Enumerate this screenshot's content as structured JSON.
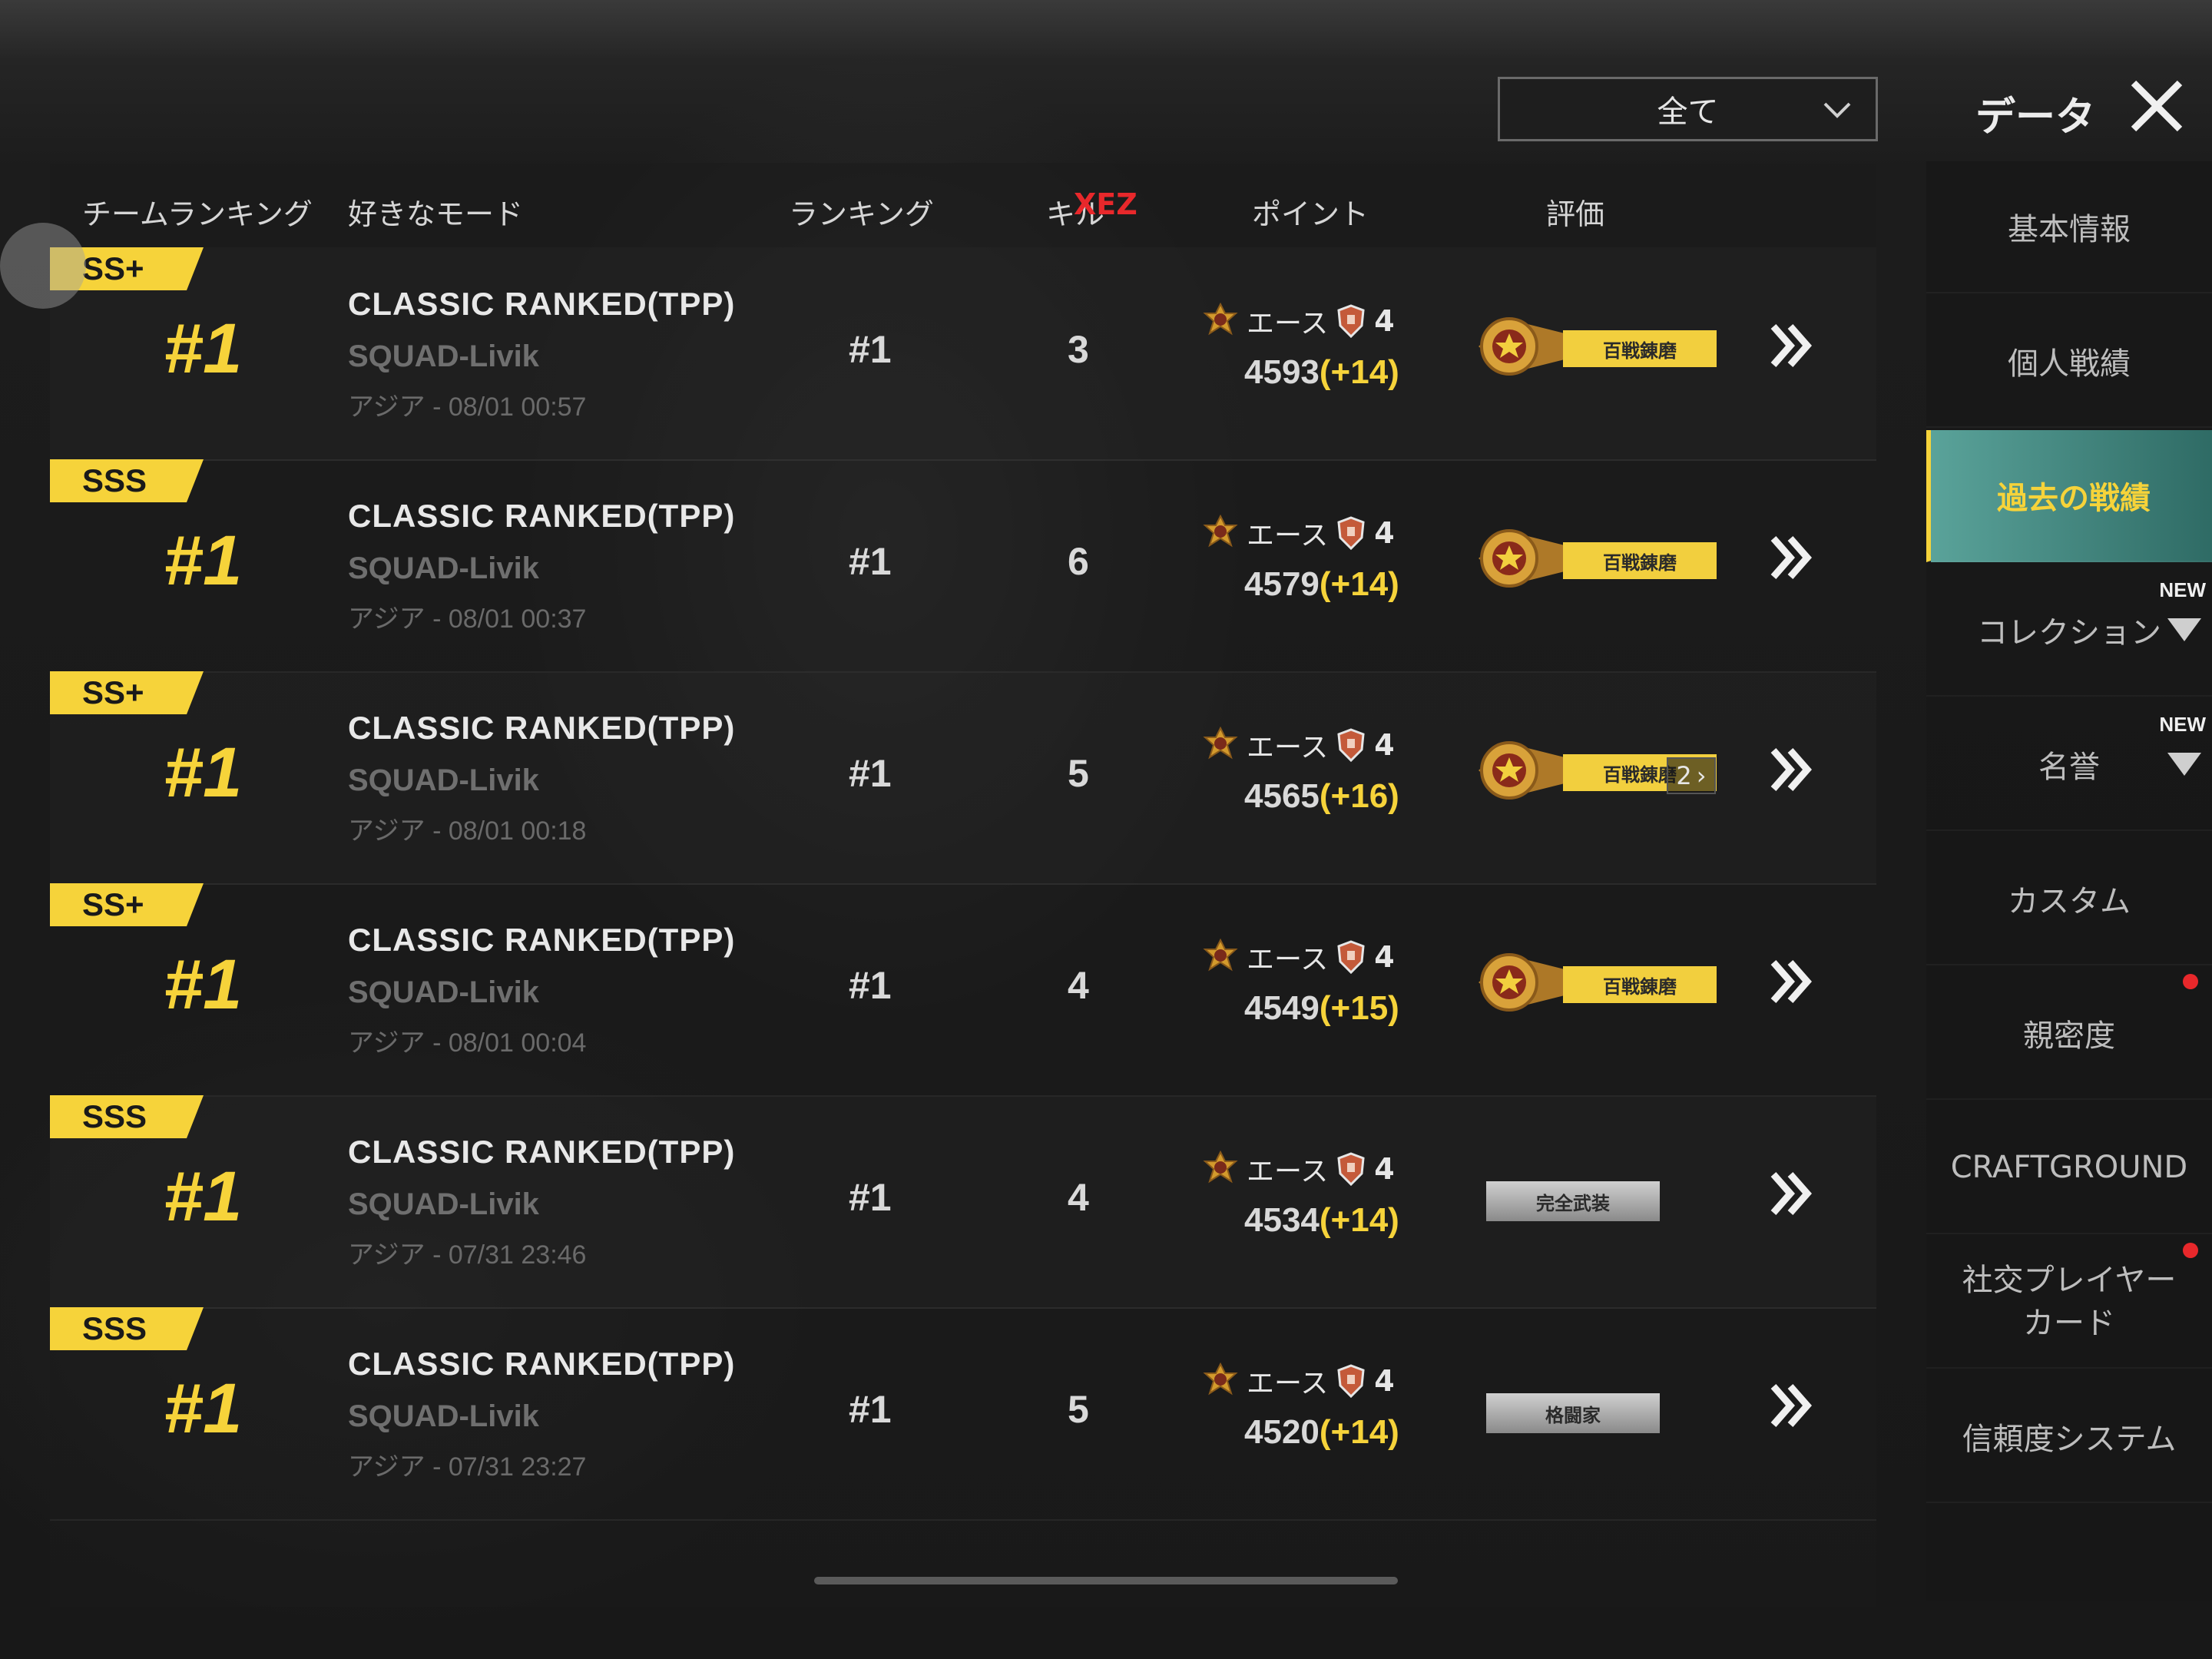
{
  "header": {
    "filter": "全て",
    "title": "データ"
  },
  "columns": {
    "team_ranking": "チームランキング",
    "favorite_mode": "好きなモード",
    "ranking": "ランキング",
    "kills": "キル",
    "kills_overlay": "XEZ",
    "points": "ポイント",
    "evaluation": "評価"
  },
  "rows": [
    {
      "grade": "SS+",
      "rank_big": "#1",
      "mode": "CLASSIC RANKED(TPP)",
      "squad": "SQUAD-Livik",
      "date": "アジア - 08/01 00:57",
      "ranking": "#1",
      "kills": "3",
      "tier": "エース",
      "tier_level": "4",
      "points": "4593",
      "delta": "(+14)",
      "eval": "百戦錬磨",
      "eval_style": "gold",
      "extra": ""
    },
    {
      "grade": "SSS",
      "rank_big": "#1",
      "mode": "CLASSIC RANKED(TPP)",
      "squad": "SQUAD-Livik",
      "date": "アジア - 08/01 00:37",
      "ranking": "#1",
      "kills": "6",
      "tier": "エース",
      "tier_level": "4",
      "points": "4579",
      "delta": "(+14)",
      "eval": "百戦錬磨",
      "eval_style": "gold",
      "extra": ""
    },
    {
      "grade": "SS+",
      "rank_big": "#1",
      "mode": "CLASSIC RANKED(TPP)",
      "squad": "SQUAD-Livik",
      "date": "アジア - 08/01 00:18",
      "ranking": "#1",
      "kills": "5",
      "tier": "エース",
      "tier_level": "4",
      "points": "4565",
      "delta": "(+16)",
      "eval": "百戦錬磨",
      "eval_style": "gold",
      "extra": "2"
    },
    {
      "grade": "SS+",
      "rank_big": "#1",
      "mode": "CLASSIC RANKED(TPP)",
      "squad": "SQUAD-Livik",
      "date": "アジア - 08/01 00:04",
      "ranking": "#1",
      "kills": "4",
      "tier": "エース",
      "tier_level": "4",
      "points": "4549",
      "delta": "(+15)",
      "eval": "百戦錬磨",
      "eval_style": "gold",
      "extra": ""
    },
    {
      "grade": "SSS",
      "rank_big": "#1",
      "mode": "CLASSIC RANKED(TPP)",
      "squad": "SQUAD-Livik",
      "date": "アジア - 07/31 23:46",
      "ranking": "#1",
      "kills": "4",
      "tier": "エース",
      "tier_level": "4",
      "points": "4534",
      "delta": "(+14)",
      "eval": "完全武装",
      "eval_style": "grey",
      "extra": ""
    },
    {
      "grade": "SSS",
      "rank_big": "#1",
      "mode": "CLASSIC RANKED(TPP)",
      "squad": "SQUAD-Livik",
      "date": "アジア - 07/31 23:27",
      "ranking": "#1",
      "kills": "5",
      "tier": "エース",
      "tier_level": "4",
      "points": "4520",
      "delta": "(+14)",
      "eval": "格闘家",
      "eval_style": "grey",
      "extra": ""
    }
  ],
  "sidebar": {
    "items": [
      {
        "label": "基本情報"
      },
      {
        "label": "個人戦績"
      },
      {
        "label": "過去の戦績",
        "active": true
      },
      {
        "label": "コレクション",
        "new": "NEW"
      },
      {
        "label": "名誉",
        "new": "NEW"
      },
      {
        "label": "カスタム"
      },
      {
        "label": "親密度",
        "dot": true
      },
      {
        "label": "CRAFTGROUND"
      },
      {
        "label": "社交プレイヤーカード",
        "dot": true
      },
      {
        "label": "信頼度システム"
      }
    ]
  },
  "colors": {
    "accent_yellow": "#f6d33a",
    "active_teal": "#5aa39a",
    "alert_red": "#e8282b"
  }
}
